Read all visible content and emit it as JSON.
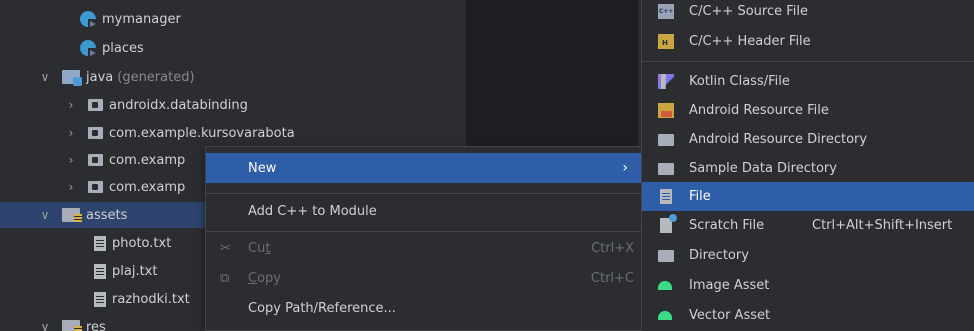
{
  "tree": {
    "rows": [
      {
        "label": "mymanager",
        "suffix": "",
        "icon": "kotlin-class-icon",
        "arrow": ""
      },
      {
        "label": "places",
        "suffix": "",
        "icon": "kotlin-class-icon",
        "arrow": ""
      },
      {
        "label": "java",
        "suffix": "(generated)",
        "icon": "java-folder-icon",
        "arrow": "∨"
      },
      {
        "label": "androidx.databinding",
        "suffix": "",
        "icon": "package-icon",
        "arrow": "›"
      },
      {
        "label": "com.example.kursovarabota",
        "suffix": "",
        "icon": "package-icon",
        "arrow": "›"
      },
      {
        "label": "com.examp",
        "suffix": "",
        "icon": "package-icon",
        "arrow": "›"
      },
      {
        "label": "com.examp",
        "suffix": "",
        "icon": "package-icon",
        "arrow": "›"
      },
      {
        "label": "assets",
        "suffix": "",
        "icon": "assets-folder-icon",
        "arrow": "∨"
      },
      {
        "label": "photo.txt",
        "suffix": "",
        "icon": "text-file-icon",
        "arrow": ""
      },
      {
        "label": "plaj.txt",
        "suffix": "",
        "icon": "text-file-icon",
        "arrow": ""
      },
      {
        "label": "razhodki.txt",
        "suffix": "",
        "icon": "text-file-icon",
        "arrow": ""
      },
      {
        "label": "res",
        "suffix": "",
        "icon": "res-folder-icon",
        "arrow": "∨"
      }
    ]
  },
  "context_menu": {
    "new_label": "New",
    "submenu_arrow": "›",
    "add_cpp_label": "Add C++ to Module",
    "cut_label_pre": "Cu",
    "cut_label_ul": "t",
    "cut_shortcut": "Ctrl+X",
    "copy_label_ul": "C",
    "copy_label_post": "opy",
    "copy_shortcut": "Ctrl+C",
    "copy_path_label": "Copy Path/Reference..."
  },
  "submenu": {
    "items": [
      {
        "label": "C/C++ Source File",
        "shortcut": ""
      },
      {
        "label": "C/C++ Header File",
        "shortcut": ""
      },
      {
        "label": "Kotlin Class/File",
        "shortcut": ""
      },
      {
        "label": "Android Resource File",
        "shortcut": ""
      },
      {
        "label": "Android Resource Directory",
        "shortcut": ""
      },
      {
        "label": "Sample Data Directory",
        "shortcut": ""
      },
      {
        "label": "File",
        "shortcut": ""
      },
      {
        "label": "Scratch File",
        "shortcut": "Ctrl+Alt+Shift+Insert"
      },
      {
        "label": "Directory",
        "shortcut": ""
      },
      {
        "label": "Image Asset",
        "shortcut": ""
      },
      {
        "label": "Vector Asset",
        "shortcut": ""
      }
    ]
  },
  "colors": {
    "background": "#2b2d30",
    "selection": "#2e5ea8",
    "tree_selection": "#2e436e"
  }
}
